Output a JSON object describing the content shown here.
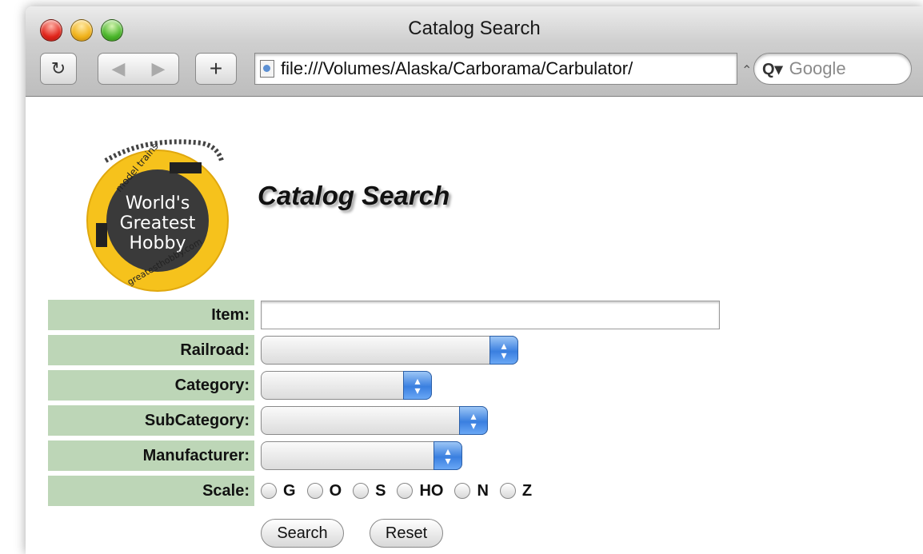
{
  "window": {
    "title": "Catalog Search"
  },
  "toolbar": {
    "reload_glyph": "↻",
    "back_glyph": "◀",
    "forward_glyph": "▶",
    "add_glyph": "+",
    "url": "file:///Volumes/Alaska/Carborama/Carbulator/",
    "search_placeholder": "Google",
    "search_icon_glyph": "Q▾"
  },
  "logo": {
    "text_line1": "World's",
    "text_line2": "Greatest",
    "text_line3": "Hobby",
    "ring_top": "model trains",
    "ring_bottom": "greatesthobby.com"
  },
  "page": {
    "title": "Catalog Search"
  },
  "form": {
    "item_label": "Item:",
    "railroad_label": "Railroad:",
    "category_label": "Category:",
    "subcategory_label": "SubCategory:",
    "manufacturer_label": "Manufacturer:",
    "scale_label": "Scale:",
    "scales": [
      "G",
      "O",
      "S",
      "HO",
      "N",
      "Z"
    ],
    "search_button": "Search",
    "reset_button": "Reset"
  },
  "colors": {
    "label_bg": "#bdd6b7",
    "select_arrow": "#3a7fe0",
    "logo_ring": "#f6c21c"
  }
}
